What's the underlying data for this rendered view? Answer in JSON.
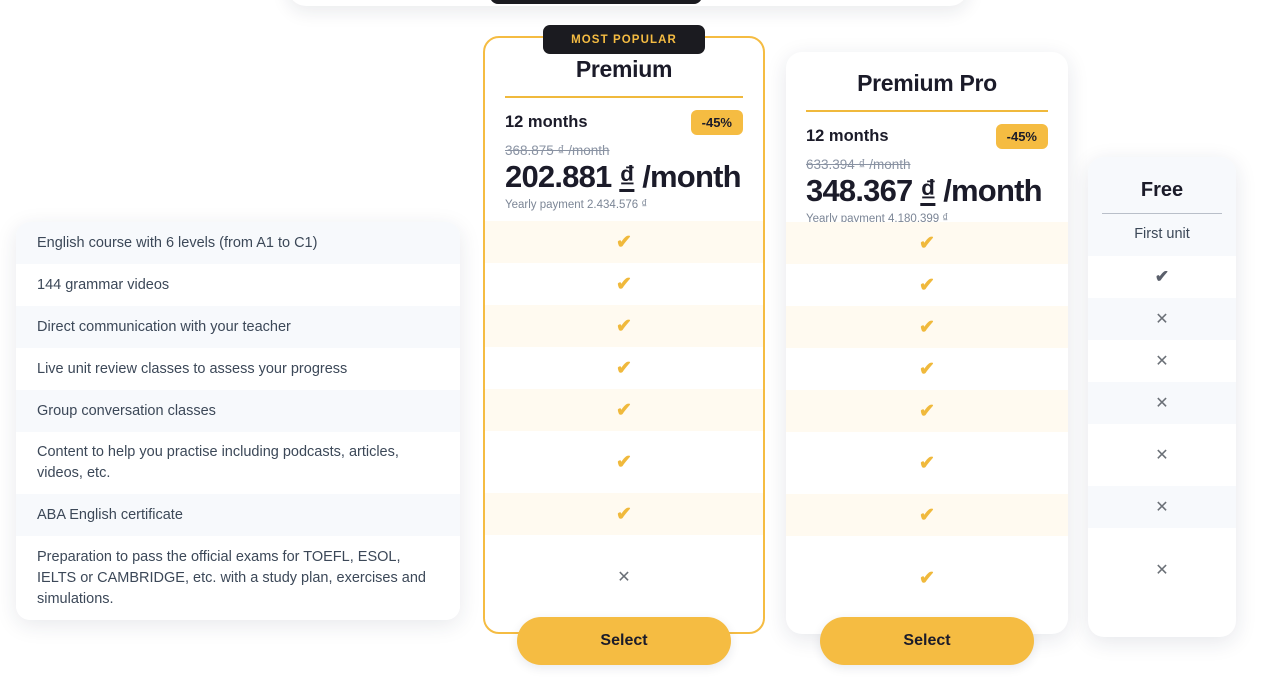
{
  "badges": {
    "most_popular": "MOST POPULAR"
  },
  "colors": {
    "accent_yellow": "#f5bc42",
    "badge_dark": "#1b1b20",
    "row_alt_cool": "#f7f9fc",
    "row_alt_warm": "#fffaf0",
    "text_primary": "#1b1b29",
    "text_body": "#3c4858",
    "text_muted": "#7c8696"
  },
  "features": [
    {
      "label": "English course with 6 levels (from A1 to C1)",
      "height": 42
    },
    {
      "label": "144 grammar videos",
      "height": 42
    },
    {
      "label": "Direct communication with your teacher",
      "height": 42
    },
    {
      "label": "Live unit review classes to assess your progress",
      "height": 42
    },
    {
      "label": "Group conversation classes",
      "height": 42
    },
    {
      "label": "Content to help you practise including podcasts, articles, videos, etc.",
      "height": 62
    },
    {
      "label": "ABA English certificate",
      "height": 42
    },
    {
      "label": "Preparation to pass the official exams for TOEFL, ESOL, IELTS or CAMBRIDGE, etc. with a study plan, exercises and simulations.",
      "height": 84
    }
  ],
  "plans": [
    {
      "id": "premium",
      "title": "Premium",
      "term": "12 months",
      "discount": "-45%",
      "old_price": "368.875 ₫ /month",
      "price_amount": "202.881",
      "price_currency": "₫",
      "price_period": "/month",
      "yearly": "Yearly payment 2.434.576 ₫",
      "cta": "Select",
      "values": [
        "check",
        "check",
        "check",
        "check",
        "check",
        "check",
        "check",
        "cross"
      ]
    },
    {
      "id": "premium-pro",
      "title": "Premium Pro",
      "term": "12 months",
      "discount": "-45%",
      "old_price": "633.394 ₫ /month",
      "price_amount": "348.367",
      "price_currency": "₫",
      "price_period": "/month",
      "yearly": "Yearly payment 4.180.399 ₫",
      "cta": "Select",
      "values": [
        "check",
        "check",
        "check",
        "check",
        "check",
        "check",
        "check",
        "check"
      ]
    },
    {
      "id": "free",
      "title": "Free",
      "first_unit_label": "First unit",
      "values": [
        "first_unit",
        "check",
        "cross",
        "cross",
        "cross",
        "cross",
        "cross",
        "cross"
      ]
    }
  ],
  "icons": {
    "check": "✔",
    "cross": "✕"
  }
}
